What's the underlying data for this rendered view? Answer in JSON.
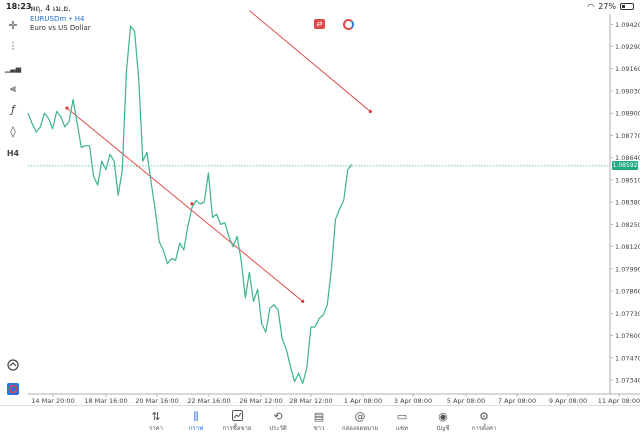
{
  "status_bar": {
    "time": "18:23",
    "date": "พฤ. 4 เม.ย.",
    "battery": "27%"
  },
  "symbol": {
    "title": "EURUSDm • H4",
    "description": "Euro vs US Dollar"
  },
  "left_toolbar": [
    {
      "name": "crosshair-icon",
      "glyph": "✛"
    },
    {
      "name": "candles-icon",
      "glyph": "⫶"
    },
    {
      "name": "bar-chart-icon",
      "glyph": "▁▃▅"
    },
    {
      "name": "indicators-icon",
      "glyph": "⫷"
    },
    {
      "name": "function-icon",
      "glyph": "ƒ"
    },
    {
      "name": "shapes-icon",
      "glyph": "◊"
    },
    {
      "name": "timeframe-label",
      "glyph": "H4"
    }
  ],
  "chart_data": {
    "type": "line",
    "y_ticks": [
      "1.09420",
      "1.09290",
      "1.09160",
      "1.09030",
      "1.08900",
      "1.08770",
      "1.08640",
      "1.08510",
      "1.08380",
      "1.08250",
      "1.08120",
      "1.07990",
      "1.07860",
      "1.07730",
      "1.07600",
      "1.07470",
      "1.07340"
    ],
    "x_ticks": [
      "14 Mar 20:00",
      "18 Mar 16:00",
      "20 Mar 16:00",
      "22 Mar 16:00",
      "26 Mar 12:00",
      "28 Mar 12:00",
      "1 Apr 08:00",
      "3 Apr 08:00",
      "5 Apr 08:00",
      "7 Apr 08:00",
      "9 Apr 08:00",
      "11 Apr 08:00"
    ],
    "ylim": [
      1.0727,
      1.0948
    ],
    "current_price": "1.08592",
    "current_price_value": 1.08592,
    "series_close": [
      1.089,
      1.0884,
      1.0879,
      1.0882,
      1.089,
      1.0887,
      1.0881,
      1.0891,
      1.0888,
      1.0882,
      1.0885,
      1.0898,
      1.0884,
      1.087,
      1.0871,
      1.0871,
      1.0853,
      1.0848,
      1.0862,
      1.0857,
      1.0866,
      1.0862,
      1.0842,
      1.0857,
      1.0914,
      1.0941,
      1.0938,
      1.091,
      1.0862,
      1.0867,
      1.085,
      1.0834,
      1.0815,
      1.081,
      1.0802,
      1.0805,
      1.0804,
      1.0814,
      1.081,
      1.0824,
      1.0835,
      1.0839,
      1.0837,
      1.0838,
      1.0855,
      1.0829,
      1.0831,
      1.0825,
      1.0826,
      1.0818,
      1.0812,
      1.0818,
      1.0804,
      1.0782,
      1.0797,
      1.078,
      1.0787,
      1.0767,
      1.0762,
      1.0776,
      1.0778,
      1.0775,
      1.0758,
      1.0752,
      1.0742,
      1.0733,
      1.0738,
      1.0732,
      1.0741,
      1.0765,
      1.0765,
      1.077,
      1.0772,
      1.0778,
      1.0799,
      1.0828,
      1.0834,
      1.0839,
      1.0857,
      1.086
    ],
    "trendlines": [
      {
        "color": "#e03c3c",
        "points": [
          {
            "i": 9.5,
            "price": 1.0893
          },
          {
            "i": 40,
            "price": 1.0837
          },
          {
            "i": 67,
            "price": 1.078
          }
        ]
      },
      {
        "color": "#e03c3c",
        "points": [
          {
            "i": 54,
            "price": 1.095
          },
          {
            "i": 83.5,
            "price": 1.0891
          }
        ]
      }
    ],
    "line_color": "#3cb48a",
    "grid": false
  },
  "bottom_nav": [
    {
      "id": "quotes",
      "label": "ราคา",
      "glyph": "⇅",
      "active": false
    },
    {
      "id": "chart",
      "label": "กราฟ",
      "glyph": "⫼",
      "active": true
    },
    {
      "id": "trade",
      "label": "การซื้อขาย",
      "glyph": "📈",
      "active": false
    },
    {
      "id": "history",
      "label": "ประวัติ",
      "glyph": "⟲",
      "active": false
    },
    {
      "id": "news",
      "label": "ข่าว",
      "glyph": "▤",
      "active": false
    },
    {
      "id": "mailbox",
      "label": "กล่องจดหมาย",
      "glyph": "@",
      "active": false
    },
    {
      "id": "chat",
      "label": "แชท",
      "glyph": "▭",
      "active": false
    },
    {
      "id": "accounts",
      "label": "บัญชี",
      "glyph": "◉",
      "active": false
    },
    {
      "id": "settings",
      "label": "การตั้งค่า",
      "glyph": "⚙",
      "active": false
    }
  ],
  "colors": {
    "accent": "#2d6ee0",
    "price_line": "#3cb48a",
    "trendline": "#e03c3c"
  }
}
